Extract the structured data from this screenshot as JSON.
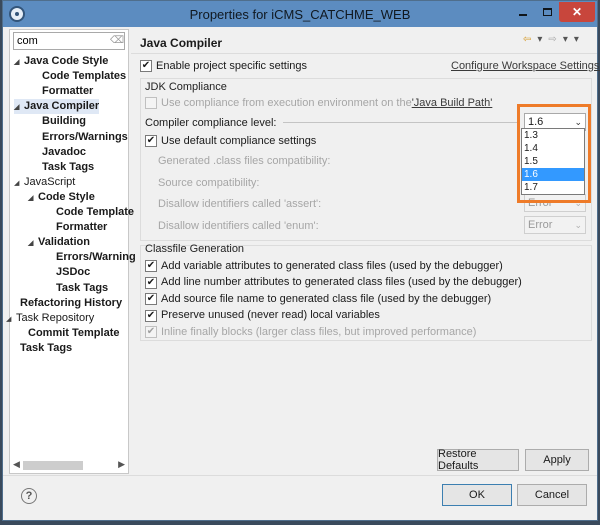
{
  "window": {
    "title": "Properties for iCMS_CATCHME_WEB"
  },
  "filter": {
    "value": "com"
  },
  "tree": [
    {
      "label": "Java Code Style",
      "bold": true,
      "level": 1,
      "arrow": "▴"
    },
    {
      "label": "Code Templates",
      "bold": true,
      "level": 2,
      "arrow": ""
    },
    {
      "label": "Formatter",
      "bold": true,
      "level": 2,
      "arrow": ""
    },
    {
      "label": "Java Compiler",
      "bold": true,
      "level": 1,
      "arrow": "▴",
      "selected": true
    },
    {
      "label": "Building",
      "bold": true,
      "level": 2,
      "arrow": ""
    },
    {
      "label": "Errors/Warnings",
      "bold": true,
      "level": 2,
      "arrow": ""
    },
    {
      "label": "Javadoc",
      "bold": true,
      "level": 2,
      "arrow": ""
    },
    {
      "label": "Task Tags",
      "bold": true,
      "level": 2,
      "arrow": ""
    },
    {
      "label": "JavaScript",
      "bold": false,
      "level": 1,
      "arrow": "▴"
    },
    {
      "label": "Code Style",
      "bold": true,
      "level": 2,
      "arrow": "▴"
    },
    {
      "label": "Code Template",
      "bold": true,
      "level": 3,
      "arrow": ""
    },
    {
      "label": "Formatter",
      "bold": true,
      "level": 3,
      "arrow": ""
    },
    {
      "label": "Validation",
      "bold": true,
      "level": 2,
      "arrow": "▴"
    },
    {
      "label": "Errors/Warning",
      "bold": true,
      "level": 3,
      "arrow": ""
    },
    {
      "label": "JSDoc",
      "bold": true,
      "level": 3,
      "arrow": ""
    },
    {
      "label": "Task Tags",
      "bold": true,
      "level": 3,
      "arrow": ""
    },
    {
      "label": "Refactoring History",
      "bold": true,
      "level": 0,
      "arrow": ""
    },
    {
      "label": "Task Repository",
      "bold": false,
      "level": 0,
      "arrow": "▴"
    },
    {
      "label": "Commit Template",
      "bold": true,
      "level": 1,
      "arrow": ""
    },
    {
      "label": "Task Tags",
      "bold": true,
      "level": 0,
      "arrow": ""
    }
  ],
  "page": {
    "title": "Java Compiler",
    "enable_specific": "Enable project specific settings",
    "configure_link": "Configure Workspace Settings...",
    "jdk_section": "JDK Compliance",
    "use_compliance_prefix": "Use compliance from execution environment on the ",
    "use_compliance_link": "'Java Build Path'",
    "compliance_level_label": "Compiler compliance level:",
    "compliance_level_value": "1.6",
    "compliance_options": [
      "1.3",
      "1.4",
      "1.5",
      "1.6",
      "1.7"
    ],
    "use_default": "Use default compliance settings",
    "generated_class": "Generated .class files compatibility:",
    "source_compat": "Source compatibility:",
    "disallow_assert": "Disallow identifiers called 'assert':",
    "disallow_assert_value": "Error",
    "disallow_enum": "Disallow identifiers called 'enum':",
    "disallow_enum_value": "Error",
    "classfile_section": "Classfile Generation",
    "classfile_options": [
      "Add variable attributes to generated class files (used by the debugger)",
      "Add line number attributes to generated class files (used by the debugger)",
      "Add source file name to generated class file (used by the debugger)",
      "Preserve unused (never read) local variables",
      "Inline finally blocks (larger class files, but improved performance)"
    ]
  },
  "buttons": {
    "restore_defaults": "Restore Defaults",
    "apply": "Apply",
    "ok": "OK",
    "cancel": "Cancel"
  },
  "colors": {
    "highlight": "#ee7b29",
    "selection": "#3399ff",
    "titlebar": "#5c8cc0",
    "close": "#c8463c"
  }
}
